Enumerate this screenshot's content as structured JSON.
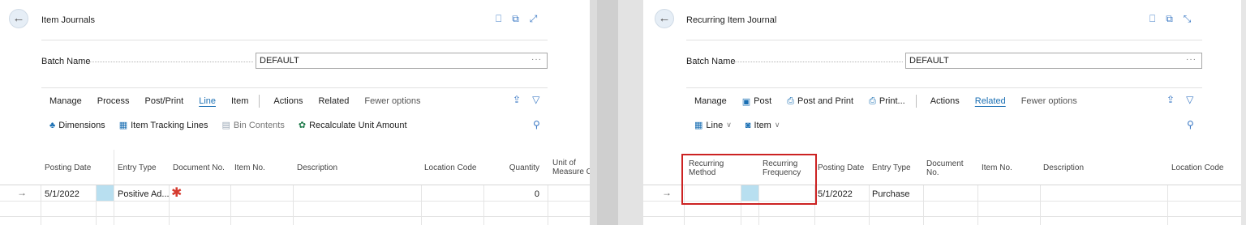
{
  "left": {
    "title": "Item Journals",
    "batch_label": "Batch Name",
    "batch_value": "DEFAULT",
    "ellipsis": "···",
    "actions": [
      {
        "label": "Manage",
        "selected": false
      },
      {
        "label": "Process",
        "selected": false
      },
      {
        "label": "Post/Print",
        "selected": false
      },
      {
        "label": "Line",
        "selected": true
      },
      {
        "label": "Item",
        "selected": false
      }
    ],
    "actions2": [
      "Actions",
      "Related",
      "Fewer options"
    ],
    "line_actions": [
      "Dimensions",
      "Item Tracking Lines",
      "Bin Contents",
      "Recalculate Unit Amount"
    ],
    "columns": [
      "Posting Date",
      "Entry Type",
      "Document No.",
      "Item No.",
      "Description",
      "Location Code",
      "Quantity",
      "Unit of",
      "Measure Co"
    ],
    "row": {
      "posting_date": "5/1/2022",
      "entry_type": "Positive Ad...",
      "required_mark": "✱",
      "quantity": "0"
    }
  },
  "right": {
    "title": "Recurring Item Journal",
    "batch_label": "Batch Name",
    "batch_value": "DEFAULT",
    "ellipsis": "···",
    "actions": [
      "Manage",
      "Post",
      "Post and Print",
      "Print..."
    ],
    "actions2": [
      {
        "label": "Actions",
        "selected": false
      },
      {
        "label": "Related",
        "selected": true
      },
      {
        "label": "Fewer options",
        "selected": false
      }
    ],
    "groups": [
      "Line",
      "Item"
    ],
    "columns": {
      "recurring_method": [
        "Recurring",
        "Method"
      ],
      "recurring_frequency": [
        "Recurring",
        "Frequency"
      ],
      "posting_date": "Posting Date",
      "entry_type": "Entry Type",
      "document_no": [
        "Document",
        "No."
      ],
      "item_no": "Item No.",
      "description": "Description",
      "location_code": "Location Code"
    },
    "row": {
      "posting_date": "5/1/2022",
      "entry_type": "Purchase"
    }
  },
  "colors": {
    "accent": "#1a6fb3",
    "highlight": "#cc2222",
    "selected_cell": "#b8dff0"
  }
}
